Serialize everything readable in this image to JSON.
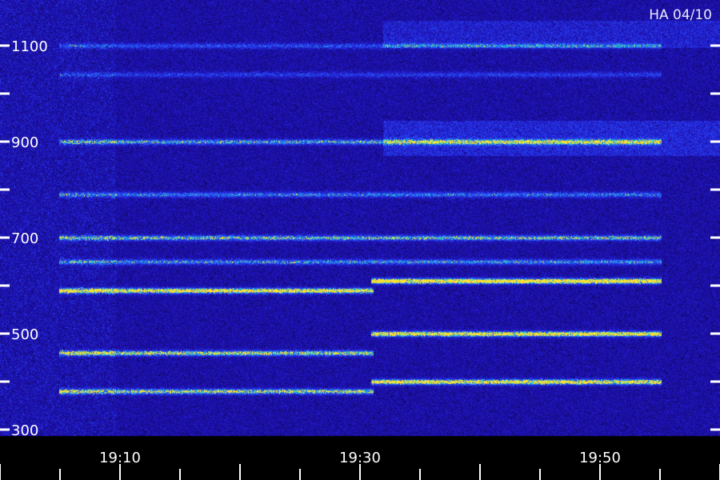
{
  "chart_data": {
    "type": "heatmap",
    "title": "",
    "xlabel": "",
    "ylabel": "",
    "corner_label": "HA 04/10",
    "y_ticks": [
      {
        "value": 300,
        "label": "300"
      },
      {
        "value": 400,
        "label": ""
      },
      {
        "value": 500,
        "label": "500"
      },
      {
        "value": 600,
        "label": ""
      },
      {
        "value": 700,
        "label": "700"
      },
      {
        "value": 800,
        "label": ""
      },
      {
        "value": 900,
        "label": "900"
      },
      {
        "value": 1000,
        "label": ""
      },
      {
        "value": 1100,
        "label": "1100"
      }
    ],
    "x_ticks": [
      {
        "value": "19:10",
        "label": "19:10"
      },
      {
        "value": "19:30",
        "label": "19:30"
      },
      {
        "value": "19:50",
        "label": "19:50"
      }
    ],
    "x_range": [
      "19:05",
      "19:55"
    ],
    "y_range": [
      290,
      1180
    ],
    "colors": {
      "background": "#000000",
      "low": "#1a0a6b",
      "mid": "#2a3cff",
      "high": "#20f0c8",
      "peak": "#ffe030"
    },
    "bands": [
      {
        "frequency": 1100,
        "start": "19:05",
        "end": "19:55",
        "intensity": 0.35
      },
      {
        "frequency": 1040,
        "start": "19:05",
        "end": "19:55",
        "intensity": 0.3
      },
      {
        "frequency": 900,
        "start": "19:05",
        "end": "19:55",
        "intensity": 0.55
      },
      {
        "frequency": 790,
        "start": "19:05",
        "end": "19:55",
        "intensity": 0.45
      },
      {
        "frequency": 700,
        "start": "19:05",
        "end": "19:55",
        "intensity": 0.6
      },
      {
        "frequency": 650,
        "start": "19:05",
        "end": "19:55",
        "intensity": 0.5
      },
      {
        "frequency": 590,
        "start": "19:05",
        "end": "19:31",
        "intensity": 0.85
      },
      {
        "frequency": 610,
        "start": "19:31",
        "end": "19:55",
        "intensity": 0.95
      },
      {
        "frequency": 460,
        "start": "19:05",
        "end": "19:31",
        "intensity": 0.7
      },
      {
        "frequency": 500,
        "start": "19:31",
        "end": "19:55",
        "intensity": 0.85
      },
      {
        "frequency": 380,
        "start": "19:05",
        "end": "19:31",
        "intensity": 0.7
      },
      {
        "frequency": 400,
        "start": "19:31",
        "end": "19:55",
        "intensity": 0.85
      }
    ]
  }
}
